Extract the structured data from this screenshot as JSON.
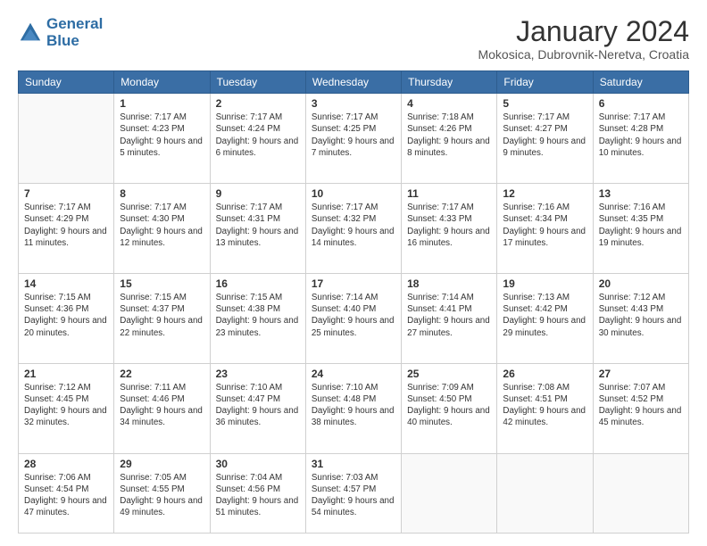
{
  "header": {
    "logo_line1": "General",
    "logo_line2": "Blue",
    "title": "January 2024",
    "subtitle": "Mokosica, Dubrovnik-Neretva, Croatia"
  },
  "days_of_week": [
    "Sunday",
    "Monday",
    "Tuesday",
    "Wednesday",
    "Thursday",
    "Friday",
    "Saturday"
  ],
  "weeks": [
    [
      {
        "num": "",
        "sunrise": "",
        "sunset": "",
        "daylight": ""
      },
      {
        "num": "1",
        "sunrise": "Sunrise: 7:17 AM",
        "sunset": "Sunset: 4:23 PM",
        "daylight": "Daylight: 9 hours and 5 minutes."
      },
      {
        "num": "2",
        "sunrise": "Sunrise: 7:17 AM",
        "sunset": "Sunset: 4:24 PM",
        "daylight": "Daylight: 9 hours and 6 minutes."
      },
      {
        "num": "3",
        "sunrise": "Sunrise: 7:17 AM",
        "sunset": "Sunset: 4:25 PM",
        "daylight": "Daylight: 9 hours and 7 minutes."
      },
      {
        "num": "4",
        "sunrise": "Sunrise: 7:18 AM",
        "sunset": "Sunset: 4:26 PM",
        "daylight": "Daylight: 9 hours and 8 minutes."
      },
      {
        "num": "5",
        "sunrise": "Sunrise: 7:17 AM",
        "sunset": "Sunset: 4:27 PM",
        "daylight": "Daylight: 9 hours and 9 minutes."
      },
      {
        "num": "6",
        "sunrise": "Sunrise: 7:17 AM",
        "sunset": "Sunset: 4:28 PM",
        "daylight": "Daylight: 9 hours and 10 minutes."
      }
    ],
    [
      {
        "num": "7",
        "sunrise": "Sunrise: 7:17 AM",
        "sunset": "Sunset: 4:29 PM",
        "daylight": "Daylight: 9 hours and 11 minutes."
      },
      {
        "num": "8",
        "sunrise": "Sunrise: 7:17 AM",
        "sunset": "Sunset: 4:30 PM",
        "daylight": "Daylight: 9 hours and 12 minutes."
      },
      {
        "num": "9",
        "sunrise": "Sunrise: 7:17 AM",
        "sunset": "Sunset: 4:31 PM",
        "daylight": "Daylight: 9 hours and 13 minutes."
      },
      {
        "num": "10",
        "sunrise": "Sunrise: 7:17 AM",
        "sunset": "Sunset: 4:32 PM",
        "daylight": "Daylight: 9 hours and 14 minutes."
      },
      {
        "num": "11",
        "sunrise": "Sunrise: 7:17 AM",
        "sunset": "Sunset: 4:33 PM",
        "daylight": "Daylight: 9 hours and 16 minutes."
      },
      {
        "num": "12",
        "sunrise": "Sunrise: 7:16 AM",
        "sunset": "Sunset: 4:34 PM",
        "daylight": "Daylight: 9 hours and 17 minutes."
      },
      {
        "num": "13",
        "sunrise": "Sunrise: 7:16 AM",
        "sunset": "Sunset: 4:35 PM",
        "daylight": "Daylight: 9 hours and 19 minutes."
      }
    ],
    [
      {
        "num": "14",
        "sunrise": "Sunrise: 7:15 AM",
        "sunset": "Sunset: 4:36 PM",
        "daylight": "Daylight: 9 hours and 20 minutes."
      },
      {
        "num": "15",
        "sunrise": "Sunrise: 7:15 AM",
        "sunset": "Sunset: 4:37 PM",
        "daylight": "Daylight: 9 hours and 22 minutes."
      },
      {
        "num": "16",
        "sunrise": "Sunrise: 7:15 AM",
        "sunset": "Sunset: 4:38 PM",
        "daylight": "Daylight: 9 hours and 23 minutes."
      },
      {
        "num": "17",
        "sunrise": "Sunrise: 7:14 AM",
        "sunset": "Sunset: 4:40 PM",
        "daylight": "Daylight: 9 hours and 25 minutes."
      },
      {
        "num": "18",
        "sunrise": "Sunrise: 7:14 AM",
        "sunset": "Sunset: 4:41 PM",
        "daylight": "Daylight: 9 hours and 27 minutes."
      },
      {
        "num": "19",
        "sunrise": "Sunrise: 7:13 AM",
        "sunset": "Sunset: 4:42 PM",
        "daylight": "Daylight: 9 hours and 29 minutes."
      },
      {
        "num": "20",
        "sunrise": "Sunrise: 7:12 AM",
        "sunset": "Sunset: 4:43 PM",
        "daylight": "Daylight: 9 hours and 30 minutes."
      }
    ],
    [
      {
        "num": "21",
        "sunrise": "Sunrise: 7:12 AM",
        "sunset": "Sunset: 4:45 PM",
        "daylight": "Daylight: 9 hours and 32 minutes."
      },
      {
        "num": "22",
        "sunrise": "Sunrise: 7:11 AM",
        "sunset": "Sunset: 4:46 PM",
        "daylight": "Daylight: 9 hours and 34 minutes."
      },
      {
        "num": "23",
        "sunrise": "Sunrise: 7:10 AM",
        "sunset": "Sunset: 4:47 PM",
        "daylight": "Daylight: 9 hours and 36 minutes."
      },
      {
        "num": "24",
        "sunrise": "Sunrise: 7:10 AM",
        "sunset": "Sunset: 4:48 PM",
        "daylight": "Daylight: 9 hours and 38 minutes."
      },
      {
        "num": "25",
        "sunrise": "Sunrise: 7:09 AM",
        "sunset": "Sunset: 4:50 PM",
        "daylight": "Daylight: 9 hours and 40 minutes."
      },
      {
        "num": "26",
        "sunrise": "Sunrise: 7:08 AM",
        "sunset": "Sunset: 4:51 PM",
        "daylight": "Daylight: 9 hours and 42 minutes."
      },
      {
        "num": "27",
        "sunrise": "Sunrise: 7:07 AM",
        "sunset": "Sunset: 4:52 PM",
        "daylight": "Daylight: 9 hours and 45 minutes."
      }
    ],
    [
      {
        "num": "28",
        "sunrise": "Sunrise: 7:06 AM",
        "sunset": "Sunset: 4:54 PM",
        "daylight": "Daylight: 9 hours and 47 minutes."
      },
      {
        "num": "29",
        "sunrise": "Sunrise: 7:05 AM",
        "sunset": "Sunset: 4:55 PM",
        "daylight": "Daylight: 9 hours and 49 minutes."
      },
      {
        "num": "30",
        "sunrise": "Sunrise: 7:04 AM",
        "sunset": "Sunset: 4:56 PM",
        "daylight": "Daylight: 9 hours and 51 minutes."
      },
      {
        "num": "31",
        "sunrise": "Sunrise: 7:03 AM",
        "sunset": "Sunset: 4:57 PM",
        "daylight": "Daylight: 9 hours and 54 minutes."
      },
      {
        "num": "",
        "sunrise": "",
        "sunset": "",
        "daylight": ""
      },
      {
        "num": "",
        "sunrise": "",
        "sunset": "",
        "daylight": ""
      },
      {
        "num": "",
        "sunrise": "",
        "sunset": "",
        "daylight": ""
      }
    ]
  ]
}
